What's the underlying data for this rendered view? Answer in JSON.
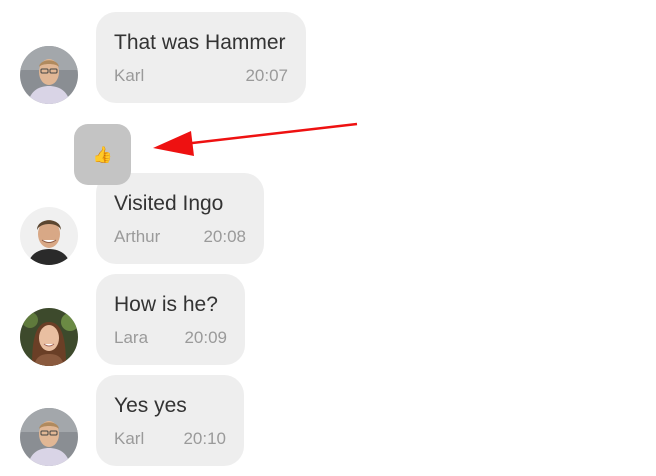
{
  "messages": [
    {
      "text": "That was Hammer",
      "sender": "Karl",
      "time": "20:07",
      "avatar": "karl-avatar"
    },
    {
      "text": "Visited Ingo",
      "sender": "Arthur",
      "time": "20:08",
      "avatar": "arthur-avatar"
    },
    {
      "text": "How is he?",
      "sender": "Lara",
      "time": "20:09",
      "avatar": "lara-avatar"
    },
    {
      "text": "Yes yes",
      "sender": "Karl",
      "time": "20:10",
      "avatar": "karl-avatar"
    }
  ],
  "reaction": {
    "emoji": "👍",
    "icon": "thumbs-up-icon"
  },
  "annotation": {
    "icon": "red-arrow-annotation",
    "color": "#ee1111"
  },
  "colors": {
    "bubble": "#eeeeee",
    "reaction_bubble": "#c4c4c4",
    "text": "#333333",
    "meta": "#9a9a9a"
  }
}
